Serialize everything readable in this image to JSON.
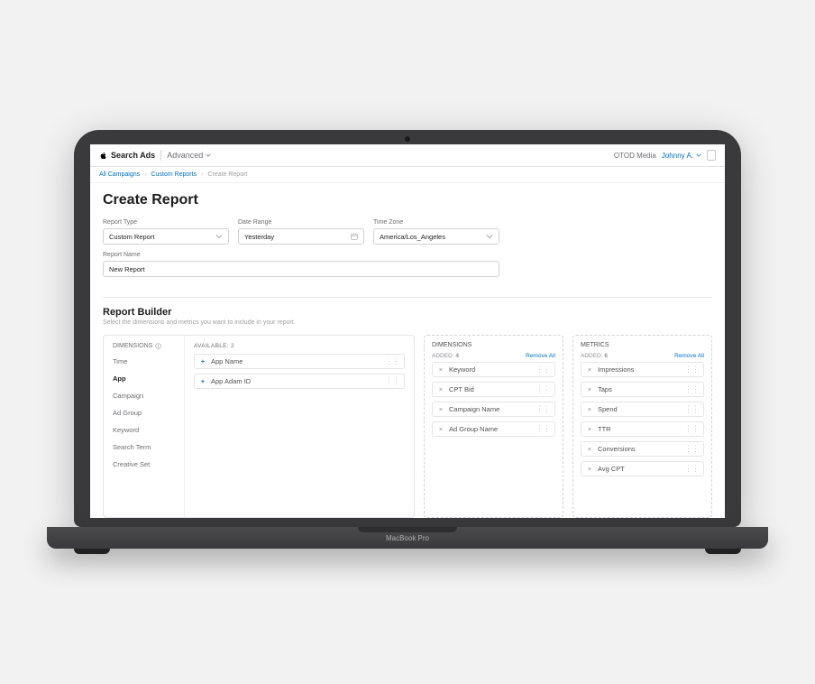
{
  "nav": {
    "brand": "Search Ads",
    "tier": "Advanced",
    "org": "OTOD Media",
    "user": "Johnny A."
  },
  "breadcrumbs": {
    "items": [
      "All Campaigns",
      "Custom Reports",
      "Create Report"
    ]
  },
  "page": {
    "title": "Create Report"
  },
  "form": {
    "report_type": {
      "label": "Report Type",
      "value": "Custom Report"
    },
    "date_range": {
      "label": "Date Range",
      "value": "Yesterday"
    },
    "time_zone": {
      "label": "Time Zone",
      "value": "America/Los_Angeles"
    },
    "report_name": {
      "label": "Report Name",
      "value": "New Report"
    }
  },
  "builder": {
    "title": "Report Builder",
    "subtitle": "Select the dimensions and metrics you want to include in your report.",
    "categories_header": "DIMENSIONS",
    "categories": [
      "Time",
      "App",
      "Campaign",
      "Ad Group",
      "Keyword",
      "Search Term",
      "Creative Set"
    ],
    "active_category": "App",
    "available": {
      "label": "AVAILABLE:",
      "count": "2",
      "items": [
        "App Name",
        "App Adam ID"
      ]
    },
    "drop_dimensions": {
      "title": "DIMENSIONS",
      "added_label": "ADDED:",
      "added_count": "4",
      "remove_all": "Remove All",
      "items": [
        "Keyword",
        "CPT Bid",
        "Campaign Name",
        "Ad Group Name"
      ]
    },
    "drop_metrics": {
      "title": "METRICS",
      "added_label": "ADDED:",
      "added_count": "6",
      "remove_all": "Remove All",
      "items": [
        "Impressions",
        "Taps",
        "Spend",
        "TTR",
        "Conversions",
        "Avg CPT"
      ]
    }
  },
  "deck_label": "MacBook Pro"
}
